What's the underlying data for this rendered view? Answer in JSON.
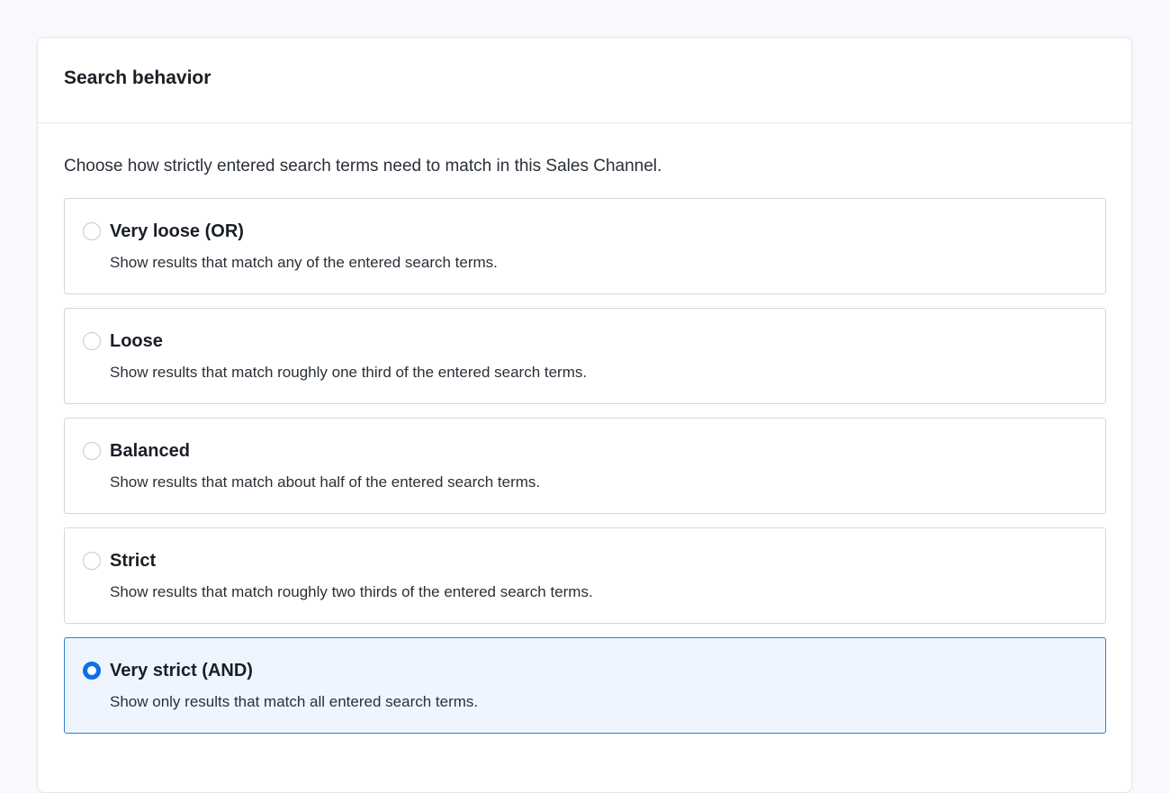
{
  "card": {
    "title": "Search behavior",
    "description": "Choose how strictly entered search terms need to match in this Sales Channel."
  },
  "options": [
    {
      "label": "Very loose (OR)",
      "description": "Show results that match any of the entered search terms.",
      "selected": false
    },
    {
      "label": "Loose",
      "description": "Show results that match roughly one third of the entered search terms.",
      "selected": false
    },
    {
      "label": "Balanced",
      "description": "Show results that match about half of the entered search terms.",
      "selected": false
    },
    {
      "label": "Strict",
      "description": "Show results that match roughly two thirds of the entered search terms.",
      "selected": false
    },
    {
      "label": "Very strict (AND)",
      "description": "Show only results that match all entered search terms.",
      "selected": true
    }
  ],
  "colors": {
    "accent": "#0f6fe8",
    "selected_background": "#eff5fe",
    "selected_border": "#2f7fcf",
    "option_border": "#d2d7de"
  }
}
